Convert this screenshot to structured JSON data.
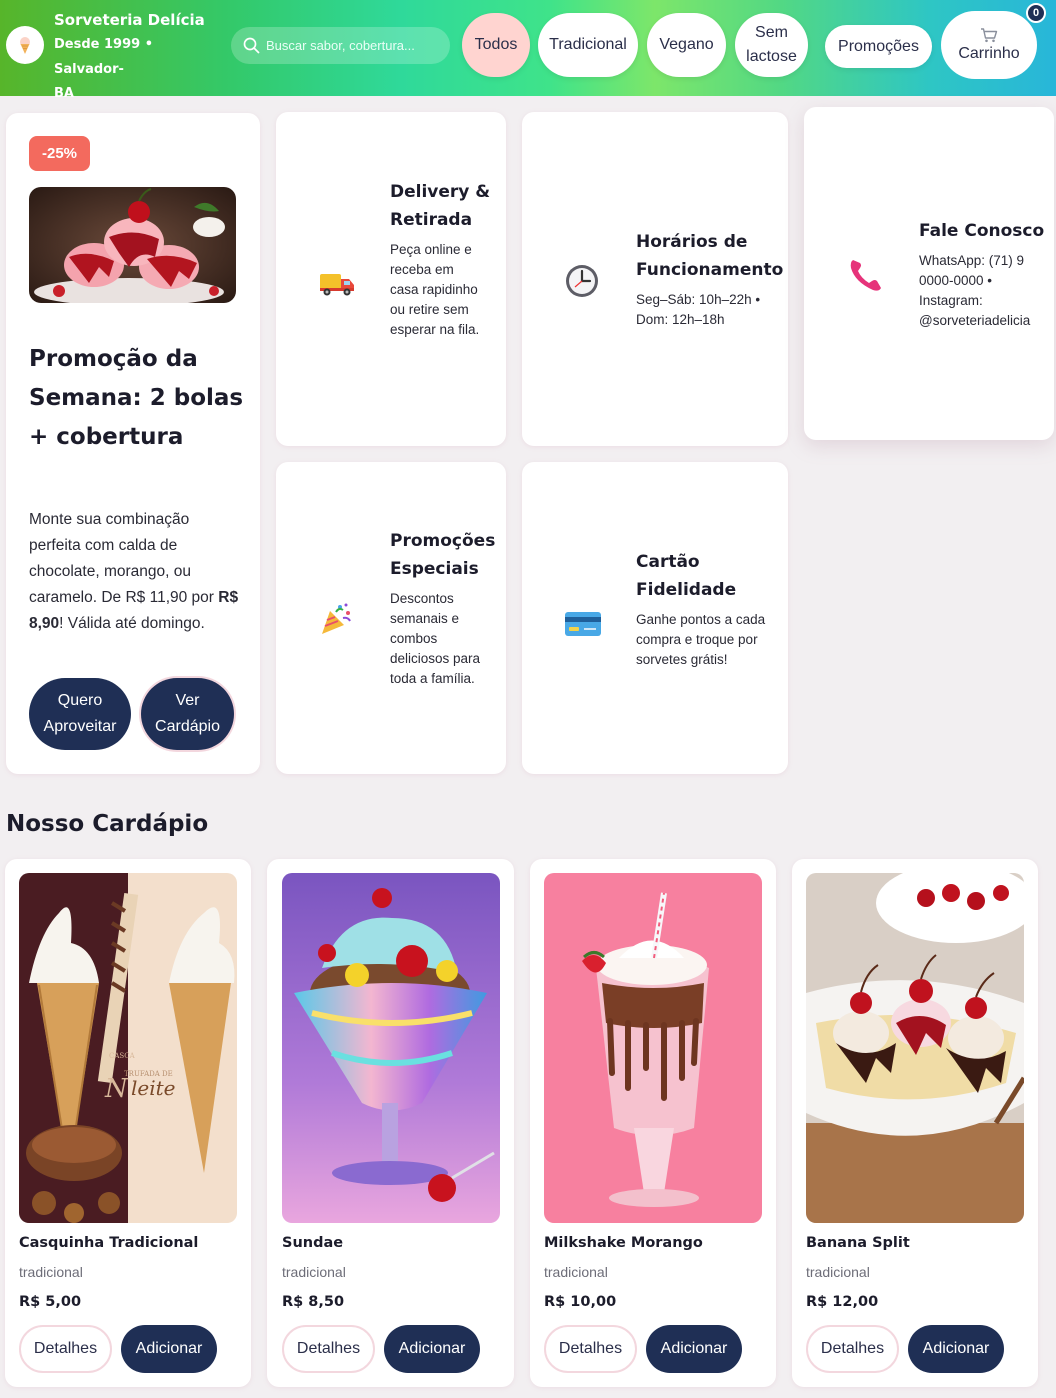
{
  "header": {
    "brand_name": "Sorveteria Delícia",
    "brand_sub_line1": "Desde 1999 • Salvador-",
    "brand_sub_line2": "BA",
    "search_placeholder": "Buscar sabor, cobertura...",
    "filters": [
      {
        "label": "Todos",
        "active": true
      },
      {
        "label": "Tradicional",
        "active": false
      },
      {
        "label": "Vegano",
        "active": false
      },
      {
        "label_line1": "Sem",
        "label_line2": "lactose",
        "active": false
      },
      {
        "label": "Promoções",
        "active": false
      }
    ],
    "cart_label": "Carrinho",
    "cart_count": "0"
  },
  "promo": {
    "tag": "-25%",
    "title": "Promoção da Semana: 2 bolas + cobertura",
    "desc_text": "Monte sua combinação perfeita com calda de chocolate, morango, ou caramelo. De R$ 11,90 por ",
    "desc_price": "R$ 8,90",
    "desc_end": "! Válida até domingo.",
    "btn_primary_line1": "Quero",
    "btn_primary_line2": "Aproveitar",
    "btn_secondary_line1": "Ver",
    "btn_secondary_line2": "Cardápio"
  },
  "info_cards": [
    {
      "icon": "delivery-truck-icon",
      "title": "Delivery & Retirada",
      "text": "Peça online e receba em casa rapidinho ou retire sem esperar na fila."
    },
    {
      "icon": "clock-icon",
      "title": "Horários de Funcionamento",
      "text": "Seg–Sáb: 10h–22h • Dom: 12h–18h"
    },
    {
      "icon": "phone-icon",
      "title": "Fale Conosco",
      "text": "WhatsApp: (71) 9 0000-0000 • Instagram: @sorveteriadelicia"
    },
    {
      "icon": "party-popper-icon",
      "title": "Promoções Especiais",
      "text": "Descontos semanais e combos deliciosos para toda a família."
    },
    {
      "icon": "credit-card-icon",
      "title": "Cartão Fidelidade",
      "text": "Ganhe pontos a cada compra e troque por sorvetes grátis!"
    }
  ],
  "menu": {
    "title": "Nosso Cardápio",
    "details_label": "Detalhes",
    "add_label": "Adicionar",
    "products": [
      {
        "name": "Casquinha Tradicional",
        "category": "tradicional",
        "price": "R$ 5,00",
        "image_text_1": "CASCA",
        "image_text_2": "TRUFADA DE",
        "image_text_3": "N",
        "image_text_4": "leite"
      },
      {
        "name": "Sundae",
        "category": "tradicional",
        "price": "R$ 8,50"
      },
      {
        "name": "Milkshake Morango",
        "category": "tradicional",
        "price": "R$ 10,00"
      },
      {
        "name": "Banana Split",
        "category": "tradicional",
        "price": "R$ 12,00"
      }
    ]
  },
  "colors": {
    "navy": "#1f2f55",
    "promo_red": "#f36a5e",
    "active_chip": "#ffd4d0",
    "page_bg": "#f2eff1"
  }
}
